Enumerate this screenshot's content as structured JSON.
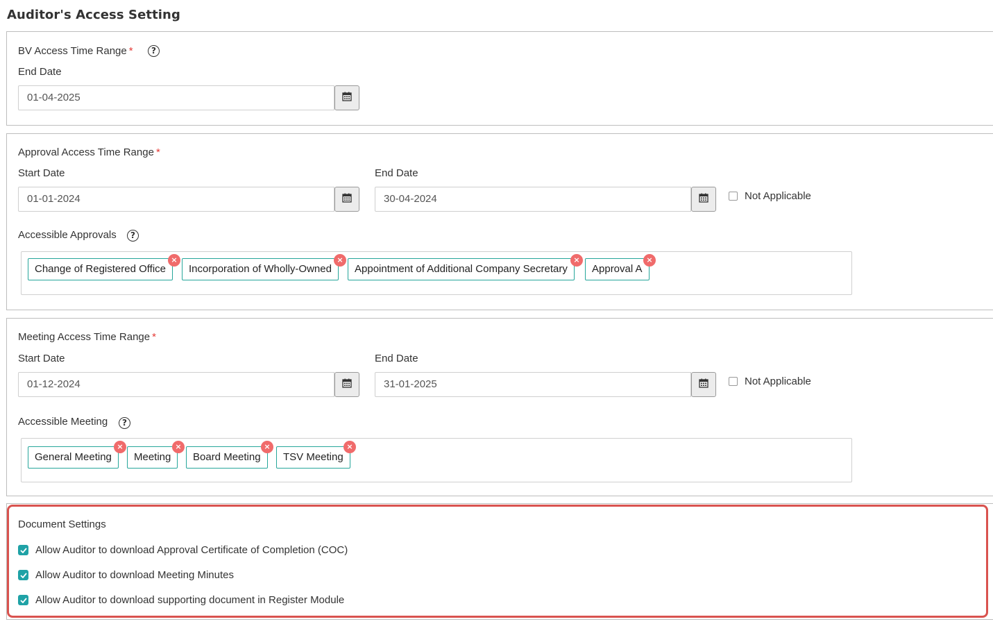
{
  "title": "Auditor's Access Setting",
  "required_mark": "*",
  "help_symbol": "?",
  "remove_symbol": "×",
  "bv": {
    "label": "BV Access Time Range",
    "end_label": "End Date",
    "end_value": "01-04-2025"
  },
  "approval": {
    "label": "Approval Access Time Range",
    "start_label": "Start Date",
    "start_value": "01-01-2024",
    "end_label": "End Date",
    "end_value": "30-04-2024",
    "not_applicable": "Not Applicable",
    "accessible_label": "Accessible Approvals",
    "tags": [
      "Change of Registered Office",
      "Incorporation of Wholly-Owned",
      "Appointment of Additional Company Secretary",
      "Approval A"
    ]
  },
  "meeting": {
    "label": "Meeting Access Time Range",
    "start_label": "Start Date",
    "start_value": "01-12-2024",
    "end_label": "End Date",
    "end_value": "31-01-2025",
    "not_applicable": "Not Applicable",
    "accessible_label": "Accessible Meeting",
    "tags": [
      "General Meeting",
      "Meeting",
      "Board Meeting",
      "TSV Meeting"
    ]
  },
  "documents": {
    "label": "Document Settings",
    "options": [
      {
        "label": "Allow Auditor to download Approval Certificate of Completion (COC)",
        "checked": true
      },
      {
        "label": "Allow Auditor to download Meeting Minutes",
        "checked": true
      },
      {
        "label": "Allow Auditor to download supporting document in Register Module",
        "checked": true
      }
    ]
  },
  "colors": {
    "accent": "#26a69a",
    "checkbox": "#1fa2a6",
    "required": "#e53935",
    "highlight_border": "#d9534f",
    "remove_badge": "#f06b6b"
  }
}
